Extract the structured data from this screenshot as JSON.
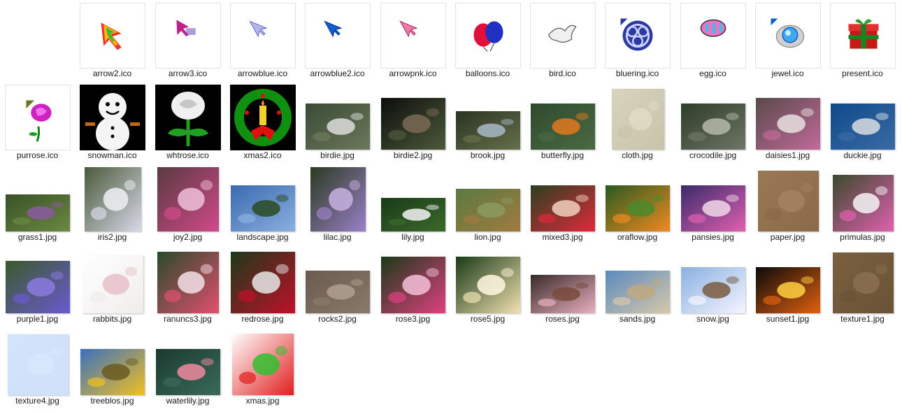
{
  "files": [
    {
      "name": "arrow2.ico",
      "kind": "ico",
      "icon": "rainbow-arrow-cursor-icon"
    },
    {
      "name": "arrow3.ico",
      "kind": "ico",
      "icon": "magenta-arrow-cursor-icon"
    },
    {
      "name": "arrowblue.ico",
      "kind": "ico",
      "icon": "light-blue-arrow-cursor-icon"
    },
    {
      "name": "arrowblue2.ico",
      "kind": "ico",
      "icon": "blue-arrow-cursor-icon"
    },
    {
      "name": "arrowpnk.ico",
      "kind": "ico",
      "icon": "pink-arrow-cursor-icon"
    },
    {
      "name": "balloons.ico",
      "kind": "ico",
      "icon": "balloons-icon"
    },
    {
      "name": "bird.ico",
      "kind": "ico",
      "icon": "dove-icon"
    },
    {
      "name": "bluering.ico",
      "kind": "ico",
      "icon": "blue-knot-ring-icon"
    },
    {
      "name": "egg.ico",
      "kind": "ico",
      "icon": "easter-egg-icon"
    },
    {
      "name": "jewel.ico",
      "kind": "ico",
      "icon": "jewel-icon"
    },
    {
      "name": "present.ico",
      "kind": "ico",
      "icon": "gift-box-icon"
    },
    {
      "name": "purrose.ico",
      "kind": "ico",
      "icon": "purple-rose-icon"
    },
    {
      "name": "snowman.ico",
      "kind": "ico-dark",
      "icon": "snowman-icon"
    },
    {
      "name": "whtrose.ico",
      "kind": "ico-dark",
      "icon": "white-rose-icon"
    },
    {
      "name": "xmas2.ico",
      "kind": "ico-dark",
      "icon": "christmas-wreath-icon"
    },
    {
      "name": "birdie.jpg",
      "kind": "jpg",
      "icon": "bird-on-post-photo",
      "colors": [
        "#3a4a36",
        "#6b7a5a",
        "#ddd"
      ],
      "r": [
        0.72,
        1
      ]
    },
    {
      "name": "birdie2.jpg",
      "kind": "jpg",
      "icon": "hummingbird-photo",
      "colors": [
        "#0d0d0d",
        "#4d5a3a",
        "#7a6a55"
      ],
      "r": [
        0.8,
        1
      ]
    },
    {
      "name": "brook.jpg",
      "kind": "jpg",
      "icon": "brook-photo",
      "colors": [
        "#2b3322",
        "#66704a",
        "#a8b8c8"
      ],
      "r": [
        0.6,
        1
      ]
    },
    {
      "name": "butterfly.jpg",
      "kind": "jpg",
      "icon": "butterfly-photo",
      "colors": [
        "#2f4a2e",
        "#4a6a42",
        "#e07820"
      ],
      "r": [
        0.72,
        1
      ]
    },
    {
      "name": "cloth.jpg",
      "kind": "jpg",
      "icon": "cloth-texture-photo",
      "colors": [
        "#d8d3bd",
        "#c9c3aa",
        "#e1dcc8"
      ],
      "r": [
        0.95,
        0.81
      ]
    },
    {
      "name": "crocodile.jpg",
      "kind": "jpg",
      "icon": "crocodile-photo",
      "colors": [
        "#2d3d28",
        "#6f7565",
        "#b5b8a8"
      ],
      "r": [
        0.72,
        1
      ]
    },
    {
      "name": "daisies1.jpg",
      "kind": "jpg",
      "icon": "daisies-photo",
      "colors": [
        "#5a4a4a",
        "#c06a9a",
        "#e8e0e0"
      ],
      "r": [
        0.8,
        1
      ]
    },
    {
      "name": "duckie.jpg",
      "kind": "jpg",
      "icon": "duck-on-water-photo",
      "colors": [
        "#0f4a8a",
        "#3a6aa5",
        "#d8dde0"
      ],
      "r": [
        0.72,
        1
      ]
    },
    {
      "name": "grass1.jpg",
      "kind": "jpg",
      "icon": "grass-photo",
      "colors": [
        "#3a5028",
        "#6a8a40",
        "#8a5aa0"
      ],
      "r": [
        0.58,
        1
      ]
    },
    {
      "name": "iris2.jpg",
      "kind": "jpg",
      "icon": "iris-flower-photo",
      "colors": [
        "#4a5a3a",
        "#d8d8e8",
        "#f0f0f5"
      ],
      "r": [
        1,
        0.88
      ]
    },
    {
      "name": "joy2.jpg",
      "kind": "jpg",
      "icon": "pink-lily-photo",
      "colors": [
        "#5a3a40",
        "#d04a8a",
        "#f0c0d8"
      ],
      "r": [
        1,
        0.96
      ]
    },
    {
      "name": "landscape.jpg",
      "kind": "jpg",
      "icon": "landscape-photo",
      "colors": [
        "#3a6ab0",
        "#8ab0e0",
        "#2a4a20"
      ],
      "r": [
        0.72,
        1
      ]
    },
    {
      "name": "lilac.jpg",
      "kind": "jpg",
      "icon": "lilac-photo",
      "colors": [
        "#2a3a20",
        "#9a80c8",
        "#c8b0e0"
      ],
      "r": [
        1,
        0.86
      ]
    },
    {
      "name": "lily.jpg",
      "kind": "jpg",
      "icon": "white-lily-photo",
      "colors": [
        "#1a3a18",
        "#3a6a2a",
        "#f5f5f5"
      ],
      "r": [
        0.52,
        1
      ]
    },
    {
      "name": "lion.jpg",
      "kind": "jpg",
      "icon": "lion-photo",
      "colors": [
        "#5a7a40",
        "#a07a40",
        "#8a9a60"
      ],
      "r": [
        0.66,
        1
      ]
    },
    {
      "name": "mixed3.jpg",
      "kind": "jpg",
      "icon": "mixed-flowers-photo",
      "colors": [
        "#2a4020",
        "#e02a3a",
        "#f0d0c0"
      ],
      "r": [
        0.72,
        1
      ]
    },
    {
      "name": "oraflow.jpg",
      "kind": "jpg",
      "icon": "bird-of-paradise-photo",
      "colors": [
        "#2a5a20",
        "#f08a20",
        "#4a8a2a"
      ],
      "r": [
        0.72,
        1
      ]
    },
    {
      "name": "pansies.jpg",
      "kind": "jpg",
      "icon": "pansies-photo",
      "colors": [
        "#3a2a6a",
        "#e060b0",
        "#f0d8e8"
      ],
      "r": [
        0.72,
        1
      ]
    },
    {
      "name": "paper.jpg",
      "kind": "jpg",
      "icon": "paper-texture-photo",
      "colors": [
        "#9a7855",
        "#8a6a48",
        "#a48260"
      ],
      "r": [
        0.95,
        0.95
      ]
    },
    {
      "name": "primulas.jpg",
      "kind": "jpg",
      "icon": "primulas-photo",
      "colors": [
        "#3a4a2a",
        "#e060b0",
        "#f5f5f5"
      ],
      "r": [
        0.88,
        0.95
      ]
    },
    {
      "name": "purple1.jpg",
      "kind": "jpg",
      "icon": "purple-flower-photo",
      "colors": [
        "#3a5a2a",
        "#6a5ad0",
        "#8a7ae0"
      ],
      "r": [
        0.82,
        1
      ]
    },
    {
      "name": "rabbits.jpg",
      "kind": "jpg",
      "icon": "rabbits-photo",
      "colors": [
        "#ffffff",
        "#f0ecec",
        "#e8c0c8"
      ],
      "r": [
        0.9,
        0.95
      ]
    },
    {
      "name": "ranuncs3.jpg",
      "kind": "jpg",
      "icon": "ranunculus-photo",
      "colors": [
        "#2a4a2a",
        "#e05070",
        "#f5e0e8"
      ],
      "r": [
        0.96,
        0.96
      ]
    },
    {
      "name": "redrose.jpg",
      "kind": "jpg",
      "icon": "red-rose-photo",
      "colors": [
        "#1a3a18",
        "#c0102a",
        "#e8e8e8"
      ],
      "r": [
        0.96,
        1
      ]
    },
    {
      "name": "rocks2.jpg",
      "kind": "jpg",
      "icon": "rocks-photo",
      "colors": [
        "#6a5a50",
        "#8a7a6a",
        "#b0a090"
      ],
      "r": [
        0.66,
        1
      ]
    },
    {
      "name": "rose3.jpg",
      "kind": "jpg",
      "icon": "pink-rose-photo",
      "colors": [
        "#1a3a18",
        "#e04080",
        "#f5c0d8"
      ],
      "r": [
        0.88,
        1
      ]
    },
    {
      "name": "rose5.jpg",
      "kind": "jpg",
      "icon": "cream-rose-photo",
      "colors": [
        "#1a3a18",
        "#f0e0b0",
        "#fff8e0"
      ],
      "r": [
        0.88,
        1
      ]
    },
    {
      "name": "roses.jpg",
      "kind": "jpg",
      "icon": "roses-photo",
      "colors": [
        "#3a2a28",
        "#e8b0c0",
        "#7a4a3a"
      ],
      "r": [
        0.6,
        1
      ]
    },
    {
      "name": "sands.jpg",
      "kind": "jpg",
      "icon": "sand-dunes-photo",
      "colors": [
        "#5a8ac0",
        "#d8c8a8",
        "#c0a880"
      ],
      "r": [
        0.66,
        1
      ]
    },
    {
      "name": "snow.jpg",
      "kind": "jpg",
      "icon": "snow-cabin-photo",
      "colors": [
        "#8ab0e0",
        "#f5f5ff",
        "#7a5a40"
      ],
      "r": [
        0.72,
        1
      ]
    },
    {
      "name": "sunset1.jpg",
      "kind": "jpg",
      "icon": "sunset-photo",
      "colors": [
        "#0a0a0a",
        "#e06010",
        "#ffd040"
      ],
      "r": [
        0.72,
        1
      ]
    },
    {
      "name": "texture1.jpg",
      "kind": "jpg",
      "icon": "wood-texture-photo",
      "colors": [
        "#7a6040",
        "#6a5236",
        "#8a7050"
      ],
      "r": [
        0.95,
        0.95
      ]
    },
    {
      "name": "texture4.jpg",
      "kind": "jpg",
      "icon": "light-blue-texture-photo",
      "colors": [
        "#d2e4fb",
        "#cfe1f9",
        "#d6e7fc"
      ],
      "r": [
        0.95,
        0.95
      ]
    },
    {
      "name": "treeblos.jpg",
      "kind": "jpg",
      "icon": "tree-blossom-photo",
      "colors": [
        "#3a70c0",
        "#f0c020",
        "#6a5a20"
      ],
      "r": [
        0.72,
        1
      ]
    },
    {
      "name": "waterlily.jpg",
      "kind": "jpg",
      "icon": "water-lily-photo",
      "colors": [
        "#1a3a30",
        "#3a6a5a",
        "#f08aa0"
      ],
      "r": [
        0.72,
        1
      ]
    },
    {
      "name": "xmas.jpg",
      "kind": "jpg",
      "icon": "santa-abstract-photo",
      "colors": [
        "#ffffff",
        "#e02020",
        "#30c030"
      ],
      "r": [
        0.96,
        0.96
      ]
    }
  ]
}
